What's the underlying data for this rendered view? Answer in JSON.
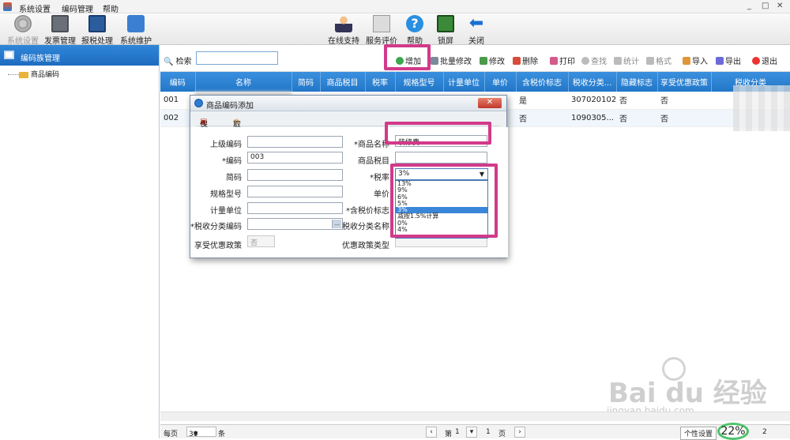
{
  "menu": [
    "系统设置",
    "编码管理",
    "帮助"
  ],
  "window_controls": [
    "_",
    "□",
    "✕"
  ],
  "toolbar_left": [
    {
      "label": "系统设置",
      "icon": "gear-icon"
    },
    {
      "label": "发票管理",
      "icon": "invoice-icon"
    },
    {
      "label": "报税处理",
      "icon": "monitor-icon"
    },
    {
      "label": "系统维护",
      "icon": "folder-icon"
    }
  ],
  "toolbar_right": [
    {
      "label": "在线支持",
      "icon": "support-person-icon"
    },
    {
      "label": "服务评价",
      "icon": "rating-icon"
    },
    {
      "label": "帮助",
      "icon": "help-icon"
    },
    {
      "label": "锁屏",
      "icon": "lock-icon"
    },
    {
      "label": "关闭",
      "icon": "back-arrow-icon"
    }
  ],
  "left_panel": {
    "title": "编码族管理",
    "tree_item": "商品编码"
  },
  "search": {
    "label": "检索",
    "value": ""
  },
  "actions": [
    "增加",
    "批量修改",
    "修改",
    "删除",
    "打印",
    "查找",
    "统计",
    "格式",
    "导入",
    "导出",
    "退出"
  ],
  "grid": {
    "headers": [
      "编码",
      "名称",
      "简码",
      "商品税目",
      "税率",
      "规格型号",
      "计量单位",
      "单价",
      "含税价标志",
      "税收分类...",
      "隐藏标志",
      "享受优惠政策",
      "税收分类"
    ],
    "rows": [
      [
        "001",
        "",
        "",
        "",
        "",
        "",
        "",
        "",
        "是",
        "307020102",
        "否",
        "否",
        ""
      ],
      [
        "002",
        "",
        "",
        "",
        "",
        "",
        "",
        "",
        "否",
        "1090305...",
        "否",
        "否",
        ""
      ]
    ]
  },
  "dialog": {
    "title": "商品编码添加",
    "close_label": "✕",
    "save": "保存",
    "cancel": "取消",
    "labels": {
      "parent_code": "上级编码",
      "code": "*编码",
      "short_code": "简码",
      "spec": "规格型号",
      "unit": "计量单位",
      "tax_class_code": "*税收分类编码",
      "preferential": "享受优惠政策",
      "name": "*商品名称",
      "tax_item": "商品税目",
      "tax_rate": "*税率",
      "price": "单价",
      "tax_incl": "*含税价标志",
      "tax_class_name": "税收分类名称",
      "preferential_type": "优惠政策类型"
    },
    "values": {
      "code": "003",
      "name": "装修费",
      "tax_rate": "3%",
      "preferential": "否"
    },
    "tax_rate_options": [
      "13%",
      "9%",
      "6%",
      "5%",
      "3%",
      "减按1.5%计算",
      "0%",
      "4%"
    ],
    "tax_rate_selected_index": 4
  },
  "status": {
    "per_page_label": "每页",
    "per_page": "30",
    "unit": "条",
    "page_prefix": "第",
    "page": "1",
    "total_sep": "/",
    "total": "1",
    "page_suffix": "页",
    "settings": "个性设置",
    "count": "2",
    "badge": "22%"
  },
  "watermark": {
    "brand": "Bai du 经验",
    "url": "jingyan.baidu.com"
  }
}
